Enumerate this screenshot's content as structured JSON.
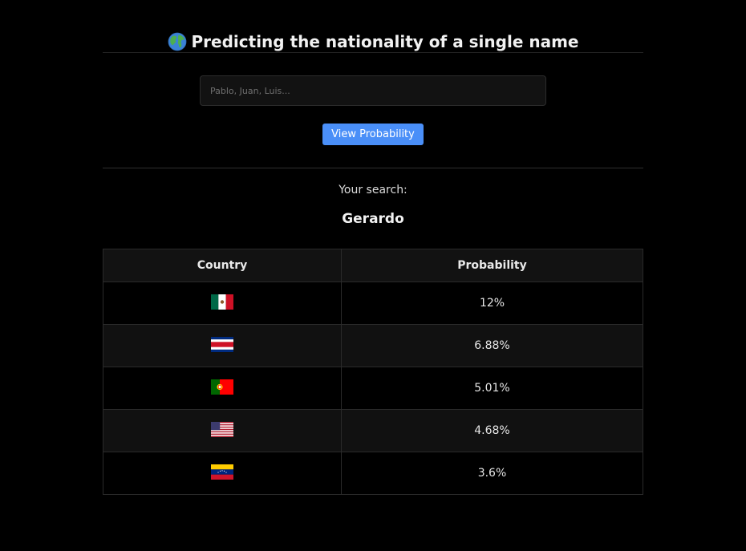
{
  "header": {
    "globe_icon": "globe-icon",
    "title": "Predicting the nationality of a single name"
  },
  "search": {
    "placeholder": "Pablo, Juan, Luis...",
    "value": ""
  },
  "button": {
    "label": "View Probability",
    "color": "#4a8ff8"
  },
  "result": {
    "label": "Your search:",
    "name": "Gerardo"
  },
  "table": {
    "columns": [
      "Country",
      "Probability"
    ],
    "rows": [
      {
        "flag": "mexico-flag",
        "probability": "12%"
      },
      {
        "flag": "costa-rica-flag",
        "probability": "6.88%"
      },
      {
        "flag": "portugal-flag",
        "probability": "5.01%"
      },
      {
        "flag": "usa-flag",
        "probability": "4.68%"
      },
      {
        "flag": "venezuela-flag",
        "probability": "3.6%"
      }
    ]
  }
}
